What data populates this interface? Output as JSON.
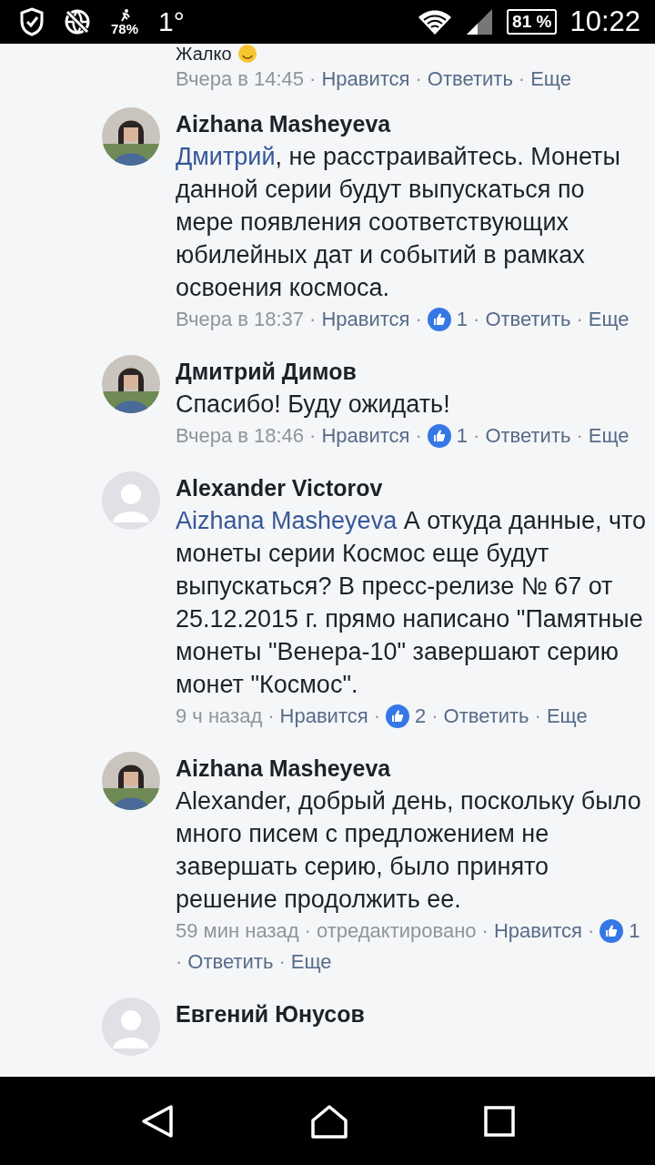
{
  "status_bar": {
    "data_saver": "78%",
    "temperature": "1°",
    "battery": "81 %",
    "time": "10:22"
  },
  "top_fragment": {
    "text": "Жалко"
  },
  "top_meta": [
    {
      "kind": "time",
      "text": "Вчера в 14:45"
    },
    {
      "kind": "sep",
      "text": "·"
    },
    {
      "kind": "link",
      "text": "Нравится"
    },
    {
      "kind": "sep",
      "text": "·"
    },
    {
      "kind": "link",
      "text": "Ответить"
    },
    {
      "kind": "sep",
      "text": "·"
    },
    {
      "kind": "link",
      "text": "Еще"
    }
  ],
  "comments": [
    {
      "author": "Aizhana Masheyeva",
      "mention": "Дмитрий",
      "text": ", не расстраивайтесь. Монеты данной серии будут выпускаться по мере появления соответствующих юбилейных дат и событий в рамках освоения космоса.",
      "meta": [
        {
          "kind": "time",
          "text": "Вчера в 18:37"
        },
        {
          "kind": "sep",
          "text": "·"
        },
        {
          "kind": "link",
          "text": "Нравится"
        },
        {
          "kind": "sep",
          "text": "·"
        },
        {
          "kind": "likes",
          "text": "1"
        },
        {
          "kind": "sep",
          "text": "·"
        },
        {
          "kind": "link",
          "text": "Ответить"
        },
        {
          "kind": "sep",
          "text": "·"
        },
        {
          "kind": "link",
          "text": "Еще"
        }
      ]
    },
    {
      "author": "Дмитрий Димов",
      "text": "Спасибо! Буду ожидать!",
      "meta": [
        {
          "kind": "time",
          "text": "Вчера в 18:46"
        },
        {
          "kind": "sep",
          "text": "·"
        },
        {
          "kind": "link",
          "text": "Нравится"
        },
        {
          "kind": "sep",
          "text": "·"
        },
        {
          "kind": "likes",
          "text": "1"
        },
        {
          "kind": "sep",
          "text": "·"
        },
        {
          "kind": "link",
          "text": "Ответить"
        },
        {
          "kind": "sep",
          "text": "·"
        },
        {
          "kind": "link",
          "text": "Еще"
        }
      ]
    },
    {
      "author": "Alexander Victorov",
      "avatar": {
        "kind": "default"
      },
      "mention": "Aizhana Masheyeva",
      "text": " А откуда данные, что монеты серии Космос еще будут выпускаться? В пресс-релизе № 67 от 25.12.2015 г. прямо написано \"Памятные монеты \"Венера-10\" завершают серию монет \"Космос\".",
      "meta": [
        {
          "kind": "time",
          "text": "9 ч назад"
        },
        {
          "kind": "sep",
          "text": "·"
        },
        {
          "kind": "link",
          "text": "Нравится"
        },
        {
          "kind": "sep",
          "text": "·"
        },
        {
          "kind": "likes",
          "text": "2"
        },
        {
          "kind": "sep",
          "text": "·"
        },
        {
          "kind": "link",
          "text": "Ответить"
        },
        {
          "kind": "sep",
          "text": "·"
        },
        {
          "kind": "link",
          "text": "Еще"
        }
      ]
    },
    {
      "author": "Aizhana Masheyeva",
      "text": "Alexander, добрый день, поскольку было много писем с предложением не завершать серию, было принято решение продолжить ее.",
      "meta": [
        {
          "kind": "time",
          "text": "59 мин назад"
        },
        {
          "kind": "sep",
          "text": "·"
        },
        {
          "kind": "time",
          "text": "отредактировано"
        },
        {
          "kind": "sep",
          "text": "·"
        },
        {
          "kind": "link",
          "text": "Нравится"
        },
        {
          "kind": "sep",
          "text": "·"
        },
        {
          "kind": "likes",
          "text": "1"
        },
        {
          "kind": "sep",
          "text": "·"
        },
        {
          "kind": "link",
          "text": "Ответить"
        },
        {
          "kind": "sep",
          "text": "·"
        },
        {
          "kind": "link",
          "text": "Еще"
        }
      ]
    },
    {
      "author": "Евгений Юнусов",
      "avatar": {
        "kind": "default"
      }
    }
  ]
}
